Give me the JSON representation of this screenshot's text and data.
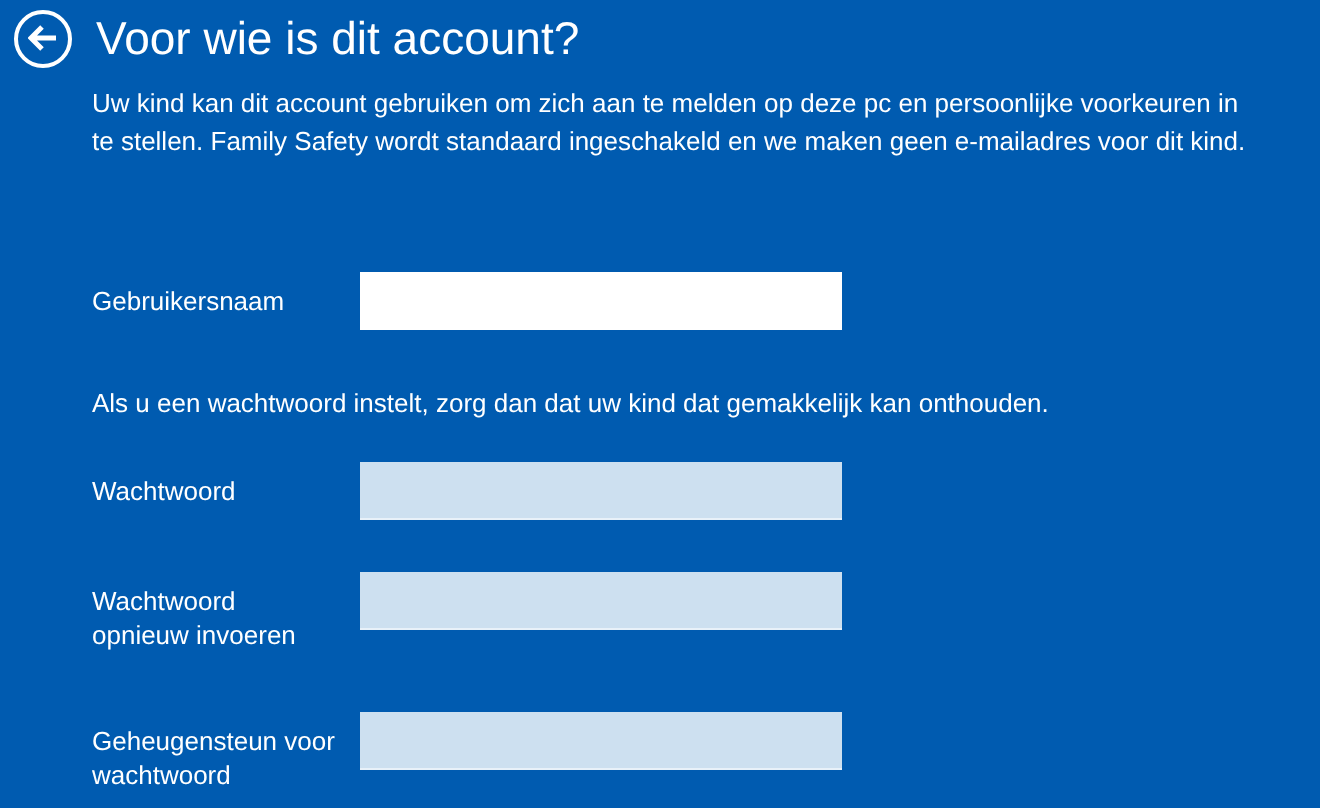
{
  "title": "Voor wie is dit account?",
  "intro": "Uw kind kan dit account gebruiken om zich aan te melden op deze pc en persoonlijke voorkeuren in te stellen. Family Safety wordt standaard ingeschakeld en we maken geen e-mailadres voor dit kind.",
  "username": {
    "label": "Gebruikersnaam",
    "focused": true
  },
  "password_hint_text": "Als u een wachtwoord instelt, zorg dan dat uw kind dat gemakkelijk kan onthouden.",
  "password_fields": [
    {
      "label": "Wachtwoord",
      "focused": false
    },
    {
      "label": "Wachtwoord opnieuw invoeren",
      "focused": false
    },
    {
      "label": "Geheugensteun voor wachtwoord",
      "focused": false
    }
  ]
}
